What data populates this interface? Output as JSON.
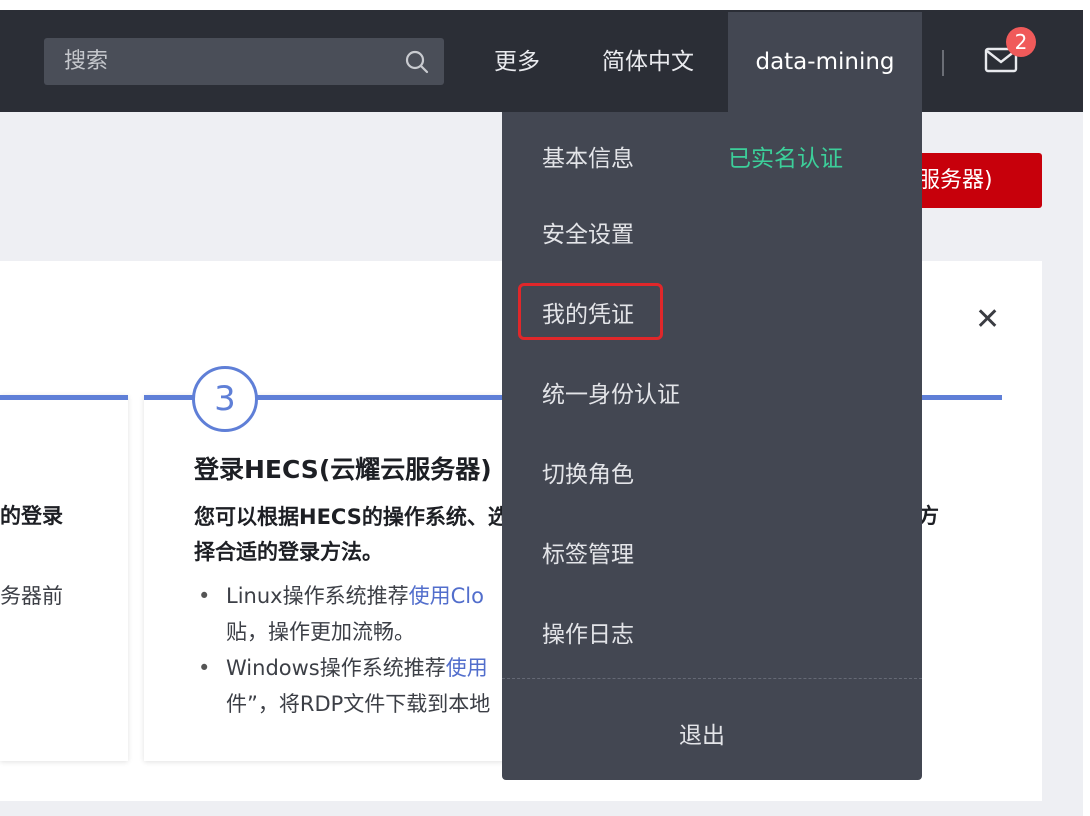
{
  "header": {
    "search_placeholder": "搜索",
    "more": "更多",
    "language": "简体中文",
    "username": "data-mining",
    "mail_badge": "2"
  },
  "page": {
    "red_button_text": "服务器)",
    "step_number": "3",
    "step_title": "登录HECS(云耀云服务器)",
    "step_desc": "您可以根据HECS的操作系统、选择合适的登录方法。",
    "left_text_1": "的登录",
    "left_text_2": "务器前",
    "right_text": "方",
    "bullets": [
      {
        "prefix": "Linux操作系统推荐",
        "link": "使用Clo",
        "suffix": "贴，操作更加流畅。"
      },
      {
        "prefix": "Windows操作系统推荐",
        "link": "使用",
        "suffix": "件”，将RDP文件下载到本地"
      }
    ]
  },
  "dropdown": {
    "basic_info": "基本信息",
    "verified": "已实名认证",
    "security": "安全设置",
    "credentials": "我的凭证",
    "unified_identity": "统一身份认证",
    "switch_role": "切换角色",
    "tag_management": "标签管理",
    "operation_log": "操作日志",
    "logout": "退出"
  },
  "colors": {
    "topbar": "#2b2e36",
    "dropdown": "#434752",
    "verified_green": "#3ccf9a",
    "highlight_red": "#e0272a",
    "accent_blue": "#5f7fd7",
    "badge_red": "#f05a5a"
  }
}
